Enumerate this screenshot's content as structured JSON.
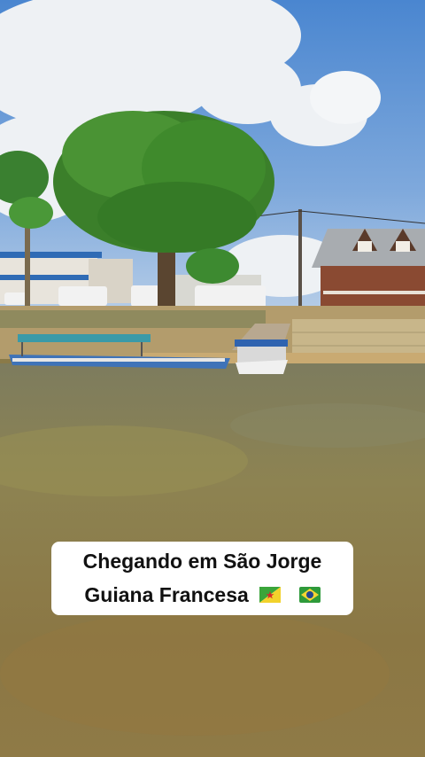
{
  "caption": {
    "line1": "Chegando em São Jorge",
    "line2": "Guiana Francesa"
  },
  "flags": [
    "french-guiana-flag-icon",
    "brazil-flag-icon"
  ],
  "colors": {
    "sky": "#5b8fd0",
    "river": "#8a7a48",
    "foliage": "#3f8a2c",
    "caption_bg": "#ffffff",
    "caption_text": "#111111"
  }
}
